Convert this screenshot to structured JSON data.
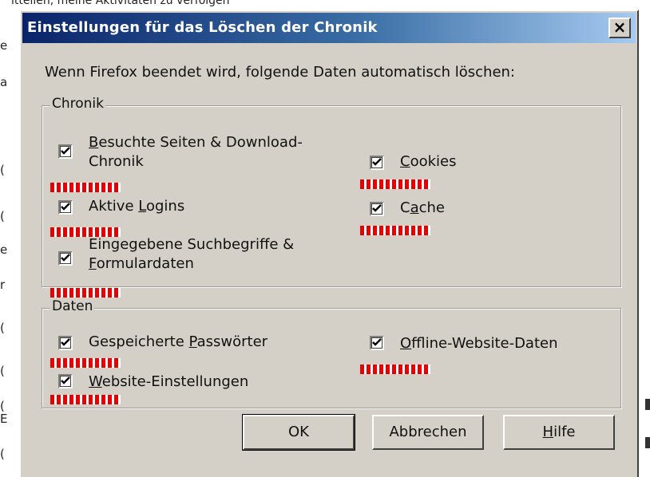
{
  "background": {
    "top_text": "itteilen, meine Aktivitäten zu verfolgen",
    "left_fragments": [
      "e",
      "a",
      "(",
      "(",
      "e",
      "r",
      "(",
      "(",
      "(",
      "E",
      "("
    ]
  },
  "dialog": {
    "title": "Einstellungen für das Löschen der Chronik",
    "close_glyph": "×",
    "intro": "Wenn Firefox beendet wird, folgende Daten automatisch löschen:",
    "groups": {
      "history": {
        "legend": "Chronik",
        "items": {
          "visited": {
            "before": "",
            "key": "B",
            "after": "esuchte Seiten & Download-",
            "line2": "Chronik",
            "checked": true
          },
          "logins": {
            "before": "Aktive ",
            "key": "L",
            "after": "ogins",
            "checked": true
          },
          "search": {
            "before": "",
            "key": "",
            "after": "Eingegebene Suchbegriffe &",
            "line2_key": "F",
            "line2_after": "ormulardaten",
            "checked": true
          },
          "cookies": {
            "before": "",
            "key": "C",
            "after": "ookies",
            "checked": true
          },
          "cache": {
            "before": "C",
            "key": "a",
            "after": "che",
            "checked": true
          }
        }
      },
      "data": {
        "legend": "Daten",
        "items": {
          "passwords": {
            "before": "Gespeicherte ",
            "key": "P",
            "after": "asswörter",
            "checked": true
          },
          "site_settings": {
            "before": "",
            "key": "W",
            "after": "ebsite-Einstellungen",
            "checked": true
          },
          "offline": {
            "before": "",
            "key": "O",
            "after": "ffline-Website-Daten",
            "checked": true
          }
        }
      }
    },
    "buttons": {
      "ok": "OK",
      "cancel": "Abbrechen",
      "help_key": "H",
      "help_after": "ilfe"
    }
  },
  "colors": {
    "dialog_face": "#d4d0c8",
    "title_start": "#0a246a",
    "title_end": "#a6caf0",
    "annotation_red": "#e60000"
  }
}
